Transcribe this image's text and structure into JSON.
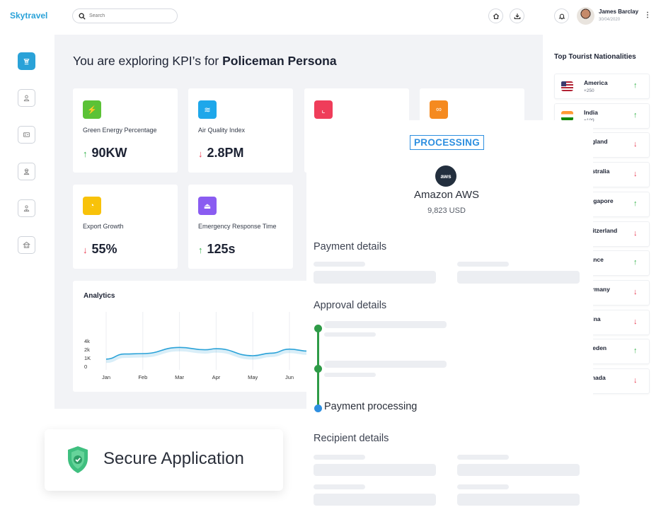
{
  "app": {
    "brand": "Skytravel"
  },
  "search": {
    "placeholder": "Search"
  },
  "user": {
    "name": "James Barclay",
    "date": "30/04/2020"
  },
  "headline": {
    "prefix": "You are exploring KPI’s for ",
    "persona": "Policeman Persona"
  },
  "kpis": [
    {
      "label": "Green Energy Percentage",
      "value": "90KW",
      "trend": "up",
      "arrow": "↑",
      "color": "#5bc236",
      "icon": "bolt-icon"
    },
    {
      "label": "Air Quality Index",
      "value": "2.8PM",
      "trend": "down",
      "arrow": "↓",
      "color": "#1ea7ea",
      "icon": "wind-icon"
    },
    {
      "label": "",
      "value": "",
      "trend": "",
      "arrow": "",
      "color": "#ef3d5a",
      "icon": "chart-icon"
    },
    {
      "label": "",
      "value": "",
      "trend": "",
      "arrow": "",
      "color": "#f58a1f",
      "icon": "binoculars-icon"
    },
    {
      "label": "Export Growth",
      "value": "55%",
      "trend": "down",
      "arrow": "↓",
      "color": "#f8c20a",
      "icon": "pie-icon"
    },
    {
      "label": "Emergency Response Time",
      "value": "125s",
      "trend": "up",
      "arrow": "↑",
      "color": "#8a5cf1",
      "icon": "alarm-icon"
    }
  ],
  "analytics": {
    "title": "Analytics"
  },
  "chart_data": {
    "type": "line",
    "title": "Analytics",
    "categories": [
      "Jan",
      "Feb",
      "Mar",
      "Apr",
      "May",
      "Jun"
    ],
    "x": [
      0,
      0.5,
      1,
      2,
      2.7,
      3,
      4,
      4.5,
      5,
      5.5
    ],
    "values": [
      850,
      1450,
      1500,
      2450,
      1950,
      2150,
      1250,
      1550,
      2050,
      1800
    ],
    "yticks": [
      "0",
      "1K",
      "2k",
      "4k"
    ],
    "ylim": [
      0,
      4000
    ],
    "line_color": "#2aa2d8",
    "grid": "vertical"
  },
  "nationalities": {
    "title": "Top Tourist Nationalities",
    "items": [
      {
        "name": "America",
        "count": "+250",
        "trend": "up",
        "arrow": "↑",
        "flag": "us"
      },
      {
        "name": "India",
        "count": "+199",
        "trend": "up",
        "arrow": "↑",
        "flag": "in"
      },
      {
        "name": "England",
        "count": "",
        "trend": "down",
        "arrow": "↓",
        "flag": ""
      },
      {
        "name": "Australia",
        "count": "",
        "trend": "down",
        "arrow": "↓",
        "flag": ""
      },
      {
        "name": "Singapore",
        "count": "",
        "trend": "up",
        "arrow": "↑",
        "flag": ""
      },
      {
        "name": "Switzerland",
        "count": "",
        "trend": "down",
        "arrow": "↓",
        "flag": ""
      },
      {
        "name": "France",
        "count": "",
        "trend": "up",
        "arrow": "↑",
        "flag": ""
      },
      {
        "name": "Germany",
        "count": "",
        "trend": "down",
        "arrow": "↓",
        "flag": ""
      },
      {
        "name": "China",
        "count": "",
        "trend": "down",
        "arrow": "↓",
        "flag": ""
      },
      {
        "name": "Sweden",
        "count": "",
        "trend": "up",
        "arrow": "↑",
        "flag": ""
      },
      {
        "name": "Canada",
        "count": "",
        "trend": "down",
        "arrow": "↓",
        "flag": ""
      }
    ]
  },
  "processing": {
    "status": "PROCESSING",
    "merchant": "Amazon AWS",
    "logo_text": "aws",
    "amount": "9,823 USD",
    "payment_details": "Payment details",
    "approval_details": "Approval details",
    "step_label": "Payment processing",
    "recipient_details": "Recipient details",
    "step_color_done": "#2e9b47",
    "step_color_current": "#2e8fe0"
  },
  "secure": {
    "label": "Secure Application",
    "color": "#3fbf7f"
  }
}
